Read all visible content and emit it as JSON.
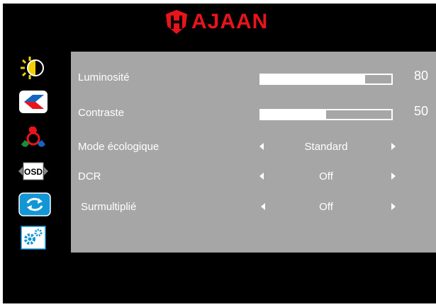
{
  "brand": {
    "name": "AJAAN",
    "mark": "H",
    "color": "#e8141c"
  },
  "sidebar": {
    "items": [
      {
        "icon": "brightness-icon"
      },
      {
        "icon": "picture-icon"
      },
      {
        "icon": "color-icon"
      },
      {
        "icon": "osd-icon",
        "label": "OSD"
      },
      {
        "icon": "reset-icon"
      },
      {
        "icon": "settings-icon"
      }
    ]
  },
  "menu": {
    "luminosite": {
      "label": "Luminosité",
      "value": "80",
      "level": 80
    },
    "contraste": {
      "label": "Contraste",
      "value": "50",
      "level": 50
    },
    "mode_ecologique": {
      "label": "Mode écologique",
      "value": "Standard"
    },
    "dcr": {
      "label": "DCR",
      "value": "Off"
    },
    "surmultiplie": {
      "label": "Surmultiplié",
      "value": "Off"
    }
  },
  "colors": {
    "panel": "#a6a6a6",
    "background": "#000000",
    "text": "#ffffff"
  }
}
